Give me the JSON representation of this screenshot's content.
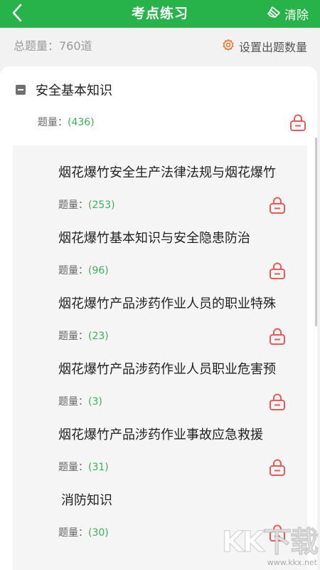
{
  "header": {
    "title": "考点练习",
    "clear_label": "清除",
    "bg_color": "#27b24a"
  },
  "subheader": {
    "total_label": "总题量：760道",
    "settings_label": "设置出题数量"
  },
  "category": {
    "title": "安全基本知识",
    "count_prefix": "题量：",
    "count": "(436)"
  },
  "items": [
    {
      "title": "烟花爆竹安全生产法律法规与烟花爆竹",
      "count_prefix": "题量：",
      "count": "(253)"
    },
    {
      "title": "烟花爆竹基本知识与安全隐患防治",
      "count_prefix": "题量：",
      "count": "(96)"
    },
    {
      "title": "烟花爆竹产品涉药作业人员的职业特殊",
      "count_prefix": "题量：",
      "count": "(23)"
    },
    {
      "title": "烟花爆竹产品涉药作业人员职业危害预",
      "count_prefix": "题量：",
      "count": "(3)"
    },
    {
      "title": "烟花爆竹产品涉药作业事故应急救援",
      "count_prefix": "题量：",
      "count": "(31)"
    },
    {
      "title": "消防知识",
      "count_prefix": "题量：",
      "count": "(30)"
    }
  ],
  "icons": {
    "back": "chevron-left-icon",
    "clear": "eraser-icon",
    "settings": "gear-icon",
    "lock": "lock-icon"
  },
  "colors": {
    "accent": "#27b24a",
    "count_green": "#3cae5c",
    "lock_red": "#e85a5a"
  },
  "watermark": {
    "logo": "KK下载",
    "url": "www.kkx.net"
  }
}
